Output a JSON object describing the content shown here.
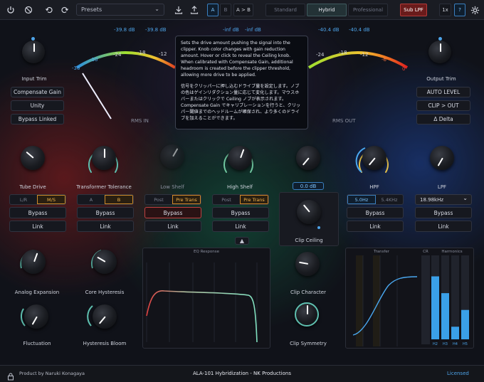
{
  "topbar": {
    "power_icon": "power-icon",
    "bypass_icon": "circle-slash-icon",
    "undo_icon": "undo-icon",
    "redo_icon": "redo-icon",
    "preset": "Presets",
    "save_icon": "save-icon",
    "load_icon": "load-icon",
    "ab": {
      "a": "A",
      "b": "B",
      "swap": "A > B"
    },
    "modes": [
      "Standard",
      "Hybrid",
      "Professional"
    ],
    "active_mode": "Hybrid",
    "sub_lpf": "Sub LPF",
    "scale": "1x",
    "help": "?",
    "settings_icon": "gear-icon"
  },
  "meters": {
    "in_peak_l": "-39.8 dB",
    "in_peak_r": "-39.8 dB",
    "mid_peak_l": "-inf dB",
    "mid_peak_r": "-inf dB",
    "out_peak_l": "-40.4 dB",
    "out_peak_r": "-40.4 dB",
    "in_label": "RMS IN",
    "out_label": "RMS OUT",
    "in_ticks": [
      "-36",
      "-30",
      "-24",
      "-18",
      "-12"
    ],
    "out_ticks": [
      "-24",
      "-18",
      "-12",
      "-6",
      "0"
    ]
  },
  "left": {
    "title": "Input Trim",
    "buttons": [
      "Compensate Gain",
      "Unity",
      "Bypass Linked"
    ]
  },
  "right": {
    "title": "Output Trim",
    "buttons": [
      "AUTO LEVEL",
      "CLIP > OUT",
      "Δ Delta"
    ]
  },
  "tooltip": {
    "en": "Sets the drive amount pushing the signal into the clipper. Knob color changes with gain reduction amount. Hover or click to reveal the Ceiling knob. When calibrated with Compensate Gain, additional headroom is created before the clipper threshold, allowing more drive to be applied.",
    "ja": "信号をクリッパーに押し込むドライブ量を設定します。ノブの色はゲインリダクション量に応じて変化します。マウスホバーまたはクリックで Ceiling ノブが表示されます。Compensate Gain でキャリブレーションを行うと、クリッパー閾値までのヘッドルームが確保され、より多くのドライブを加えることができます。"
  },
  "row": {
    "tube_drive": "Tube Drive",
    "transformer": "Transformer Tolerance",
    "low_shelf": "Low Shelf",
    "high_shelf": "High Shelf",
    "clip_value": "0.0 dB",
    "hpf": "HPF",
    "lpf": "LPF",
    "seg_stereo": [
      "L/R",
      "M/S"
    ],
    "seg_ab": [
      "A",
      "B"
    ],
    "seg_low": [
      "Post",
      "Pre Trans"
    ],
    "seg_high": [
      "Post",
      "Pre Trans"
    ],
    "hpf_freq": [
      "5.0Hz",
      "5.4KHz"
    ],
    "lpf_freq": "18.98kHz",
    "bypass": "Bypass",
    "link": "Link",
    "clip_ceiling": "Clip Ceiling"
  },
  "lower": {
    "analog_expansion": "Analog Expansion",
    "core_hysteresis": "Core Hysteresis",
    "fluctuation": "Fluctuation",
    "hysteresis_bloom": "Hysteresis Bloom",
    "clip_character": "Clip Character",
    "clip_symmetry": "Clip Symmetry",
    "eq_title": "EQ Response",
    "transfer_title": "Transfer",
    "cr_title": "CR",
    "harmonics_title": "Harmonics",
    "harm_labels": [
      "H2",
      "H3",
      "H4",
      "H5"
    ]
  },
  "chart_data": [
    {
      "type": "bar",
      "title": "Harmonics",
      "categories": [
        "H2",
        "H3",
        "H4",
        "H5"
      ],
      "values": [
        0.75,
        0.55,
        0.15,
        0.35
      ],
      "ylim": [
        0,
        1
      ]
    }
  ],
  "footer": {
    "lock_icon": "lock-icon",
    "author": "Product by Naruki Konagaya",
    "title": "ALA-101 Hybridization - NK Productions",
    "license": "Licensed"
  }
}
